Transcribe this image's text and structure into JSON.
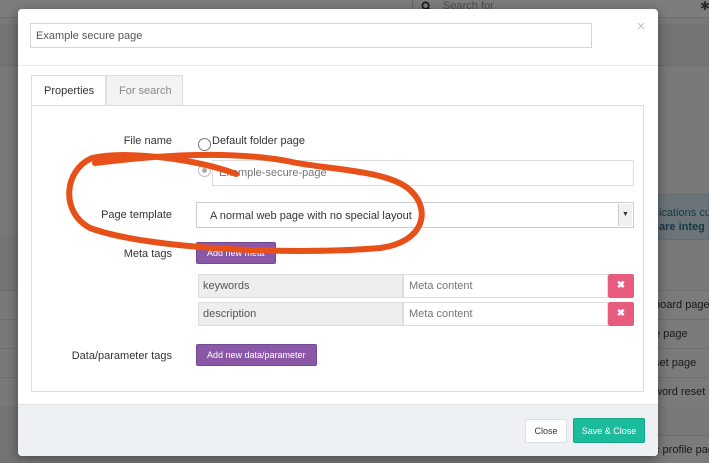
{
  "background": {
    "search_placeholder": "Search for",
    "notice_line1": "ications cu",
    "notice_line2": "are integ",
    "rows": [
      "board page",
      "e page",
      "set page",
      "word reset",
      "c profile pag"
    ]
  },
  "modal": {
    "title_value": "Example secure page",
    "close_glyph": "×",
    "tabs": [
      {
        "label": "Properties",
        "active": true
      },
      {
        "label": "For search",
        "active": false
      }
    ],
    "file_name": {
      "label": "File name",
      "option_default": "Default folder page",
      "filename_placeholder": "Example-secure-page"
    },
    "page_template": {
      "label": "Page template",
      "selected": "A normal web page with no special layout"
    },
    "meta_tags": {
      "label": "Meta tags",
      "add_button": "Add new meta",
      "rows": [
        {
          "key": "keywords",
          "content_placeholder": "Meta content"
        },
        {
          "key": "description",
          "content_placeholder": "Meta content"
        }
      ],
      "delete_glyph": "✖"
    },
    "data_params": {
      "label": "Data/parameter tags",
      "add_button": "Add new data/parameter"
    },
    "footer": {
      "close_label": "Close",
      "save_label": "Save & Close"
    }
  },
  "colors": {
    "accent_purple": "#8a58a7",
    "save_green": "#1bbc9b",
    "delete_pink": "#e75b7f",
    "annotation_orange": "#e8501a"
  }
}
